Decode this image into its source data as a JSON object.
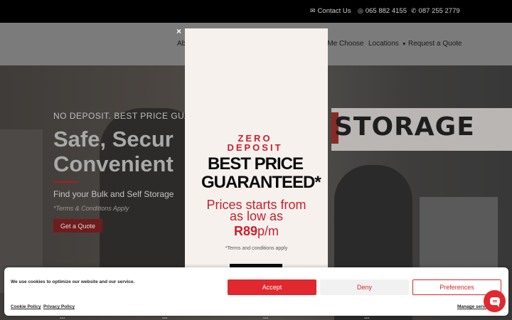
{
  "topbar": {
    "contact_label": "Contact Us",
    "phone1": "065 882 4155",
    "phone2": "087 255 2779",
    "contact_icon": "envelope-icon",
    "whatsapp_icon": "whatsapp-icon",
    "phone_icon": "phone-icon"
  },
  "nav": {
    "items": [
      {
        "label": "Ab"
      },
      {
        "label": "o Me Choose"
      },
      {
        "label": "Locations"
      },
      {
        "label": "Request a Quote"
      }
    ]
  },
  "hero": {
    "subheading": "NO DEPOSIT. BEST PRICE GUARA",
    "title_line1": "Safe, Secur",
    "title_line2": "Convenient",
    "tagline": "Find your Bulk and Self Storage",
    "terms": "*Terms & Conditions Apply",
    "cta_label": "Get a Quote",
    "sign_text": "STORAGE"
  },
  "popup": {
    "close_label": "×",
    "zero": "ZERO",
    "deposit": "DEPOSIT",
    "best_price": "BEST PRICE",
    "guaranteed": "GUARANTEED*",
    "prices_line1": "Prices starts from",
    "prices_line2": "as low as",
    "amount": "R89",
    "per": "p/m",
    "terms": "*Terms and conditions apply"
  },
  "footer_peek": [
    "...",
    "...",
    "...",
    "..."
  ],
  "cookie": {
    "message": "We use cookies to optimize our website and our service.",
    "accept_label": "Accept",
    "deny_label": "Deny",
    "preferences_label": "Preferences",
    "cookie_policy": "Cookie Policy",
    "privacy_policy": "Privacy Policy",
    "manage": "Manage servi"
  },
  "colors": {
    "accent": "#e0282e",
    "popup_bg": "#f7f1ee",
    "topbar_bg": "#000000"
  }
}
